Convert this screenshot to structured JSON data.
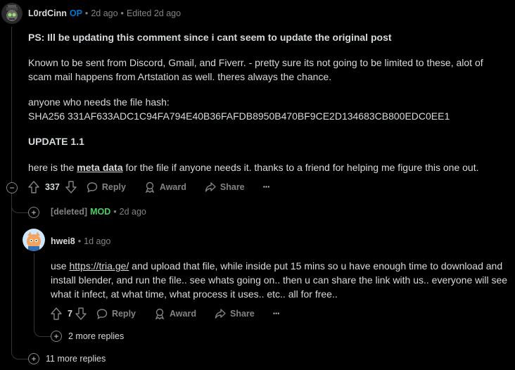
{
  "comment1": {
    "username": "L0rdCinn",
    "op_badge": "OP",
    "sep1": "•",
    "time": "2d ago",
    "sep2": "•",
    "edited": "Edited 2d ago",
    "ps_line": "PS: Ill be updating this comment since i cant seem to update the original post",
    "para1_line1": "Known to be sent from Discord, Gmail, and Fiverr. - pretty sure its not going to be limited to these, alot of",
    "para1_line2": "scam mail happens from Artstation as well. theres always the chance.",
    "hash_label": "anyone who needs the file hash:",
    "hash_value": "SHA256 331AF633ADC1C94FA794E40B36FAFDB8950B470BF9CE2D134683CB800EDC0EE1",
    "update_heading": "UPDATE 1.1",
    "meta_pre": "here is the ",
    "meta_link": "meta data",
    "meta_post": " for the file if anyone needs it. thanks to a friend for helping me figure this one out.",
    "votes": "337",
    "reply": "Reply",
    "award": "Award",
    "share": "Share",
    "more": "···"
  },
  "deleted_comment": {
    "username": "[deleted]",
    "mod_badge": "MOD",
    "sep": "•",
    "time": "2d ago"
  },
  "comment2": {
    "username": "hwei8",
    "sep": "•",
    "time": "1d ago",
    "line1_pre": "use ",
    "line1_link": "https://tria.ge/",
    "line1_post": " and upload that file, while inside put 15 mins so u have enough time to download and",
    "line2": "install blender, and run the file.. see whats going on.. then u can share the link with us.. everyone will see",
    "line3": "what it infect, at what time, what process it uses.. etc.. all for free..",
    "votes": "7",
    "reply": "Reply",
    "award": "Award",
    "share": "Share",
    "more": "···",
    "more_replies": "2 more replies"
  },
  "thread": {
    "more_replies": "11 more replies"
  },
  "colors": {
    "background": "#000000",
    "op": "#0079d3",
    "mod": "#46d160",
    "muted": "#818384"
  }
}
